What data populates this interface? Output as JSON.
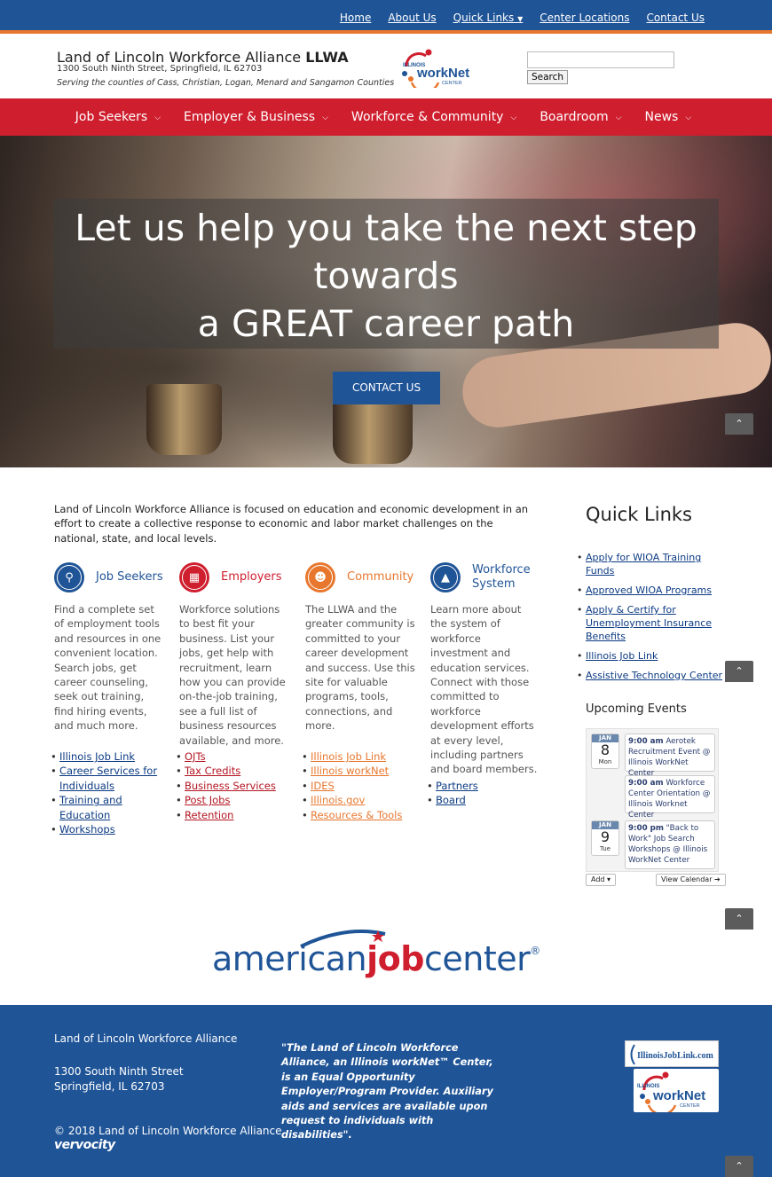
{
  "topnav": {
    "links": [
      "Home",
      "About Us",
      "Quick Links",
      "Center Locations",
      "Contact Us"
    ]
  },
  "header": {
    "org_name": "Land of Lincoln Workforce Alliance",
    "org_abbr": "LLWA",
    "address": "1300 South Ninth Street, Springfield, IL 62703",
    "serving": "Serving the counties of Cass, Christian, Logan, Menard and Sangamon Counties",
    "logo_top": "ILLINOIS",
    "logo_main": "workNet",
    "logo_sub": "CENTER",
    "search_value": "",
    "search_button": "Search"
  },
  "mainnav": {
    "items": [
      "Job Seekers",
      "Employer & Business",
      "Workforce & Community",
      "Boardroom",
      "News"
    ]
  },
  "hero": {
    "line1": "Let us help you take the next step",
    "line2": "towards",
    "line3": "a GREAT career path",
    "button": "CONTACT US"
  },
  "intro": "Land of Lincoln Workforce Alliance is focused on education and economic development in an effort to create a collective response to economic and labor market challenges on the national, state, and local levels.",
  "columns": [
    {
      "title": "Job Seekers",
      "color": "#1f5497",
      "desc": "Find a complete set of employment tools and resources in one convenient location. Search jobs, get career counseling, seek out training, find hiring events, and much more.",
      "links": [
        "Illinois Job Link",
        "Career Services for Individuals",
        "Training and Education",
        "Workshops"
      ]
    },
    {
      "title": "Employers",
      "color": "#cf1e2e",
      "desc": "Workforce solutions to best fit your business. List your jobs, get help with recruitment, learn how you can provide on-the-job training, see a full list of business resources available, and more.",
      "links": [
        "OJTs",
        "Tax Credits",
        "Business Services",
        "Post Jobs",
        "Retention"
      ]
    },
    {
      "title": "Community",
      "color": "#e8772e",
      "desc": "The LLWA and the greater community is committed to your career development and success. Use this site for valuable programs, tools, connections, and more.",
      "links": [
        "Illinois Job Link",
        "Illinois workNet",
        "IDES",
        "Illinois.gov",
        "Resources & Tools"
      ]
    },
    {
      "title": "Workforce System",
      "color": "#1f5497",
      "desc": "Learn more about the system of workforce investment and education services. Connect with those committed to workforce development efforts at every level, including partners and board members.",
      "links": [
        "Partners",
        "Board"
      ]
    }
  ],
  "quick_links": {
    "title": "Quick Links",
    "items": [
      "Apply for WIOA Training Funds",
      "Approved WIOA Programs",
      "Apply & Certify for Unemployment Insurance Benefits",
      "Illinois Job Link",
      "Assistive Technology Center"
    ]
  },
  "events": {
    "title": "Upcoming Events",
    "days": [
      {
        "month": "JAN",
        "day": "8",
        "dow": "Mon"
      },
      {
        "month": "JAN",
        "day": "9",
        "dow": "Tue"
      }
    ],
    "items": [
      {
        "time": "9:00 am",
        "text": "Aerotek Recruitment Event @ Illinois WorkNet Center"
      },
      {
        "time": "9:00 am",
        "text": "Workforce Center Orientation @ Illinois Worknet Center"
      },
      {
        "time": "9:00 pm",
        "text": "\"Back to Work\" Job Search Workshops @ Illinois WorkNet Center"
      }
    ],
    "add_button": "Add ▾",
    "view_button": "View Calendar ➔"
  },
  "ajc": {
    "part1": "american",
    "part2": "job",
    "part3": "center",
    "mark": "®"
  },
  "footer": {
    "name": "Land of Lincoln Workforce Alliance",
    "street": "1300 South Ninth Street",
    "city": "Springfield, IL 62703",
    "copyright": "© 2018 Land of Lincoln Workforce Alliance",
    "credit": "vervocity",
    "quote": "\"The Land of Lincoln Workforce Alliance, an Illinois workNet™ Center,  is an Equal Opportunity Employer/Program Provider. Auxiliary aids and services are available upon request to individuals with disabilities\".",
    "ijl_logo": "IllinoisJobLink.com"
  },
  "colors": {
    "blue": "#1f5497",
    "red": "#cf1e2e",
    "orange": "#e8772e"
  }
}
